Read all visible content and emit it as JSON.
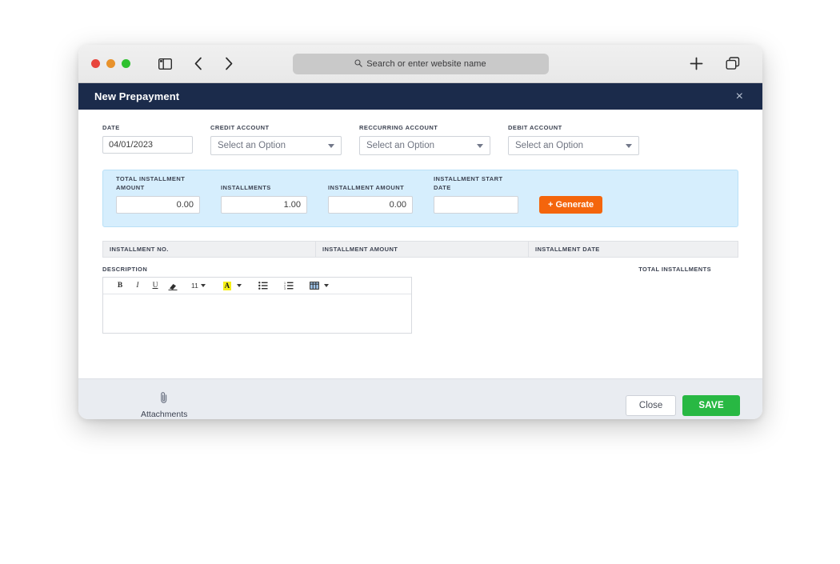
{
  "browser": {
    "url_placeholder": "Search or enter website name",
    "icons": {
      "search": "search-icon",
      "sidebar": "sidebar-toggle-icon",
      "back": "back-chevron-icon",
      "forward": "forward-chevron-icon",
      "new_tab": "plus-icon",
      "tab_overview": "tab-overview-icon"
    }
  },
  "modal": {
    "title": "New Prepayment",
    "close_label": "×",
    "fields": [
      {
        "label": "DATE",
        "value": "04/01/2023",
        "type": "text"
      },
      {
        "label": "CREDIT ACCOUNT",
        "value": "Select an Option",
        "type": "select"
      },
      {
        "label": "RECCURRING ACCOUNT",
        "value": "Select an Option",
        "type": "select"
      },
      {
        "label": "DEBIT ACCOUNT",
        "value": "Select an Option",
        "type": "select"
      }
    ],
    "installment_panel": {
      "total_installment_amount_label": "TOTAL INSTALLMENT AMOUNT",
      "total_installment_amount_value": "0.00",
      "installments_label": "INSTALLMENTS",
      "installments_value": "1.00",
      "installment_amount_label": "INSTALLMENT AMOUNT",
      "installment_amount_value": "0.00",
      "installment_start_date_label": "INSTALLMENT START DATE",
      "installment_start_date_value": "",
      "generate_button": "+ Generate"
    },
    "table": {
      "columns": [
        "INSTALLMENT NO.",
        "INSTALLMENT AMOUNT",
        "INSTALLMENT DATE"
      ],
      "rows": []
    },
    "description": {
      "label": "DESCRIPTION",
      "content": "",
      "toolbar": {
        "bold": "B",
        "italic": "I",
        "underline": "U",
        "clear_format": "clear-format-icon",
        "font_size": "11",
        "highlight": "A",
        "bullet_list": "bullet-list-icon",
        "numbered_list": "numbered-list-icon",
        "table": "table-icon"
      }
    },
    "totals_label": "TOTAL INSTALLMENTS",
    "footer": {
      "attachments_label": "Attachments",
      "close_label": "Close",
      "save_label": "SAVE"
    }
  },
  "colors": {
    "header_navy": "#1b2b4b",
    "panel_blue": "#d6eefd",
    "generate_orange": "#f4650c",
    "save_green": "#28b843",
    "footer_gray": "#e9ecf1"
  }
}
